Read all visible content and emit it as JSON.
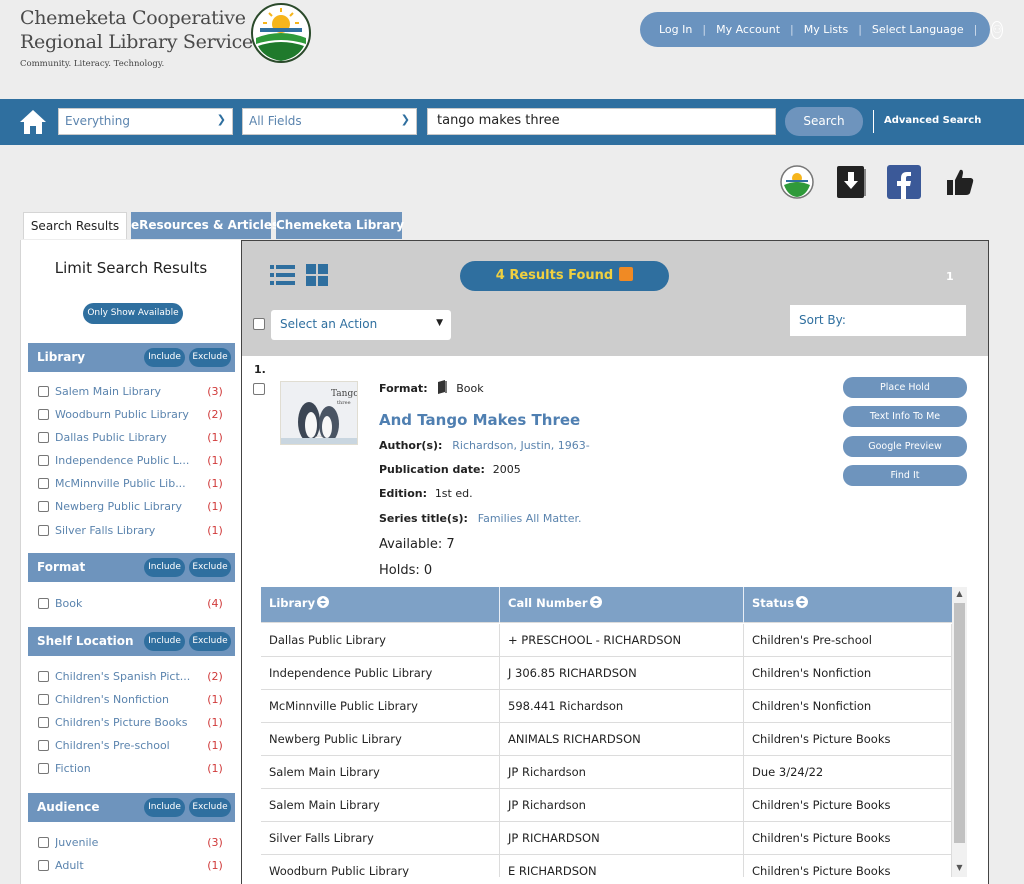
{
  "header": {
    "brand_line1": "Chemeketa Cooperative",
    "brand_line2": "Regional Library Service",
    "tagline": "Community. Literacy. Technology.",
    "nav": [
      "Log In",
      "My Account",
      "My Lists",
      "Select Language"
    ]
  },
  "search": {
    "scope": "Everything",
    "field": "All Fields",
    "query": "tango makes three",
    "button": "Search",
    "advanced": "Advanced Search"
  },
  "tabs": [
    "Search Results",
    "eResources & Articles",
    "Chemeketa Library"
  ],
  "sidebar": {
    "title": "Limit Search Results",
    "only_available": "Only Show Available",
    "include": "Include",
    "exclude": "Exclude",
    "facets": [
      {
        "name": "Library",
        "items": [
          {
            "label": "Salem Main Library",
            "count": "(3)"
          },
          {
            "label": "Woodburn Public Library",
            "count": "(2)"
          },
          {
            "label": "Dallas Public Library",
            "count": "(1)"
          },
          {
            "label": "Independence Public L...",
            "count": "(1)"
          },
          {
            "label": "McMinnville Public Lib...",
            "count": "(1)"
          },
          {
            "label": "Newberg Public Library",
            "count": "(1)"
          },
          {
            "label": "Silver Falls Library",
            "count": "(1)"
          }
        ]
      },
      {
        "name": "Format",
        "items": [
          {
            "label": "Book",
            "count": "(4)"
          }
        ]
      },
      {
        "name": "Shelf Location",
        "items": [
          {
            "label": "Children's Spanish Pict...",
            "count": "(2)"
          },
          {
            "label": "Children's Nonfiction",
            "count": "(1)"
          },
          {
            "label": "Children's Picture Books",
            "count": "(1)"
          },
          {
            "label": "Children's Pre-school",
            "count": "(1)"
          },
          {
            "label": "Fiction",
            "count": "(1)"
          }
        ]
      },
      {
        "name": "Audience",
        "items": [
          {
            "label": "Juvenile",
            "count": "(3)"
          },
          {
            "label": "Adult",
            "count": "(1)"
          }
        ]
      }
    ]
  },
  "results": {
    "summary": "4 Results Found",
    "page": "1",
    "action_placeholder": "Select an Action",
    "sort_label": "Sort By:",
    "item": {
      "number": "1.",
      "format_label": "Format:",
      "format": "Book",
      "title": "And Tango Makes Three",
      "author_label": "Author(s):",
      "author": "Richardson, Justin, 1963-",
      "pubdate_label": "Publication date:",
      "pubdate": "2005",
      "edition_label": "Edition:",
      "edition": "1st ed.",
      "series_label": "Series title(s):",
      "series": "Families All Matter.",
      "available": "Available: 7",
      "holds": "Holds: 0",
      "actions": [
        "Place Hold",
        "Text Info To Me",
        "Google Preview",
        "Find It"
      ]
    },
    "holdings": {
      "columns": [
        "Library",
        "Call Number",
        "Status"
      ],
      "rows": [
        [
          "Dallas Public Library",
          "+ PRESCHOOL - RICHARDSON",
          "Children's Pre-school"
        ],
        [
          "Independence Public Library",
          "J 306.85 RICHARDSON",
          "Children's Nonfiction"
        ],
        [
          "McMinnville Public Library",
          "598.441 Richardson",
          "Children's Nonfiction"
        ],
        [
          "Newberg Public Library",
          "ANIMALS RICHARDSON",
          "Children's Picture Books"
        ],
        [
          "Salem Main Library",
          "JP Richardson",
          "Due 3/24/22"
        ],
        [
          "Salem Main Library",
          "JP Richardson",
          "Children's Picture Books"
        ],
        [
          "Silver Falls Library",
          "JP RICHARDSON",
          "Children's Picture Books"
        ],
        [
          "Woodburn Public Library",
          "E RICHARDSON",
          "Children's Picture Books"
        ]
      ]
    }
  },
  "colors": {
    "primary": "#2f6f9f",
    "secondary": "#6e94bd",
    "link": "#5b84ae",
    "count": "#d03a3a",
    "highlight": "#f0d040"
  }
}
